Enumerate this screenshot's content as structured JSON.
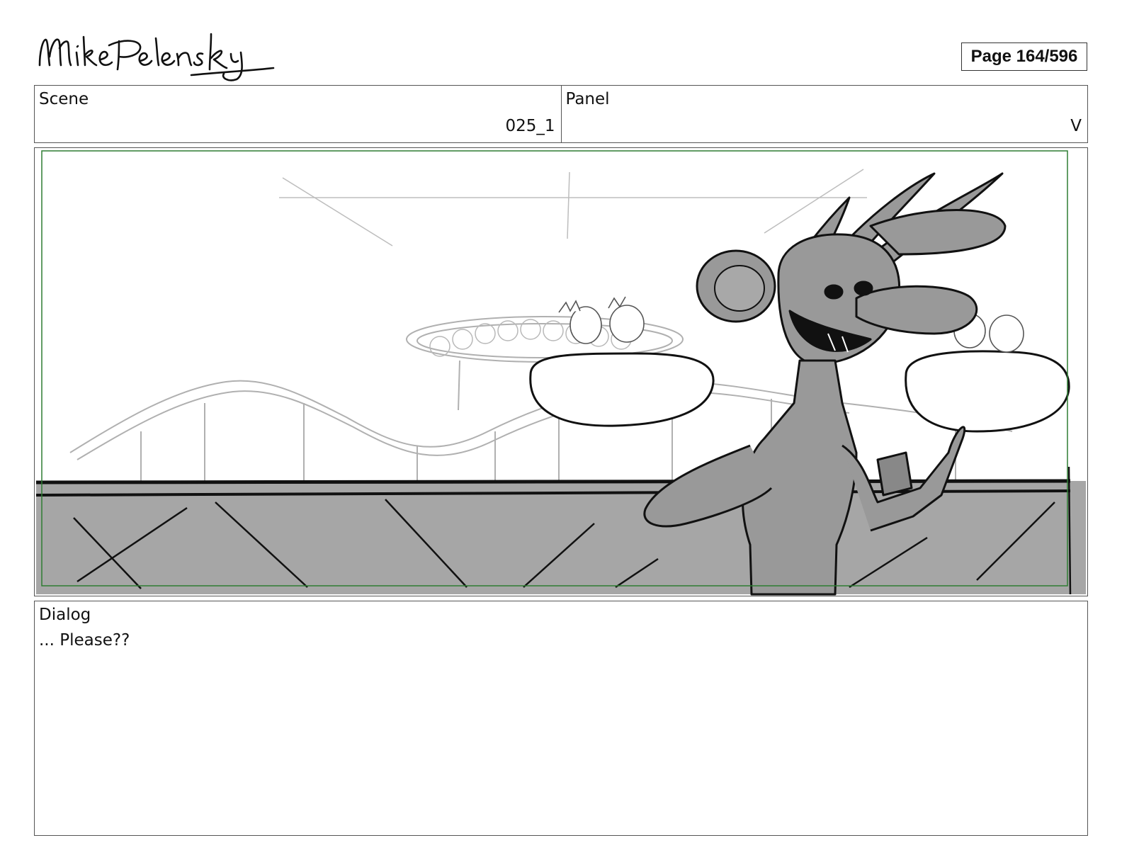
{
  "header": {
    "logo_text": "Mike Pelensky",
    "page_label": "Page 164/596"
  },
  "info": {
    "scene_label": "Scene",
    "scene_value": "025_1",
    "panel_label": "Panel",
    "panel_value": "V"
  },
  "dialog": {
    "label": "Dialog",
    "text": "... Please??"
  },
  "colors": {
    "safe_frame": "#2e7d32",
    "sketch_gray": "#9e9e9e",
    "fill_gray": "#a6a6a6"
  }
}
